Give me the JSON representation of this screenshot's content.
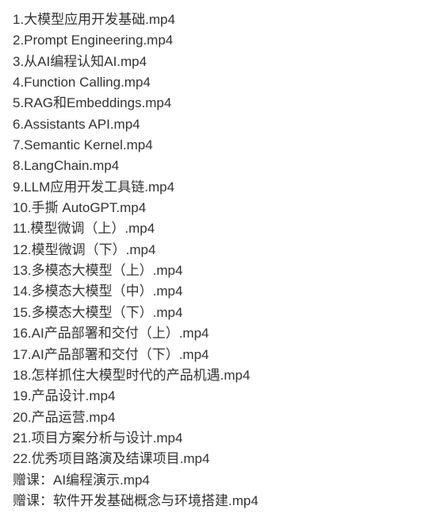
{
  "files": [
    "1.大模型应用开发基础.mp4",
    "2.Prompt Engineering.mp4",
    "3.从AI编程认知AI.mp4",
    "4.Function Calling.mp4",
    "5.RAG和Embeddings.mp4",
    "6.Assistants API.mp4",
    "7.Semantic Kernel.mp4",
    "8.LangChain.mp4",
    "9.LLM应用开发工具链.mp4",
    "10.手撕 AutoGPT.mp4",
    "11.模型微调（上）.mp4",
    "12.模型微调（下）.mp4",
    "13.多模态大模型（上）.mp4",
    "14.多模态大模型（中）.mp4",
    "15.多模态大模型（下）.mp4",
    "16.AI产品部署和交付（上）.mp4",
    "17.AI产品部署和交付（下）.mp4",
    "18.怎样抓住大模型时代的产品机遇.mp4",
    "19.产品设计.mp4",
    "20.产品运营.mp4",
    "21.项目方案分析与设计.mp4",
    "22.优秀项目路演及结课项目.mp4",
    "赠课：AI编程演示.mp4",
    "赠课：软件开发基础概念与环境搭建.mp4"
  ]
}
